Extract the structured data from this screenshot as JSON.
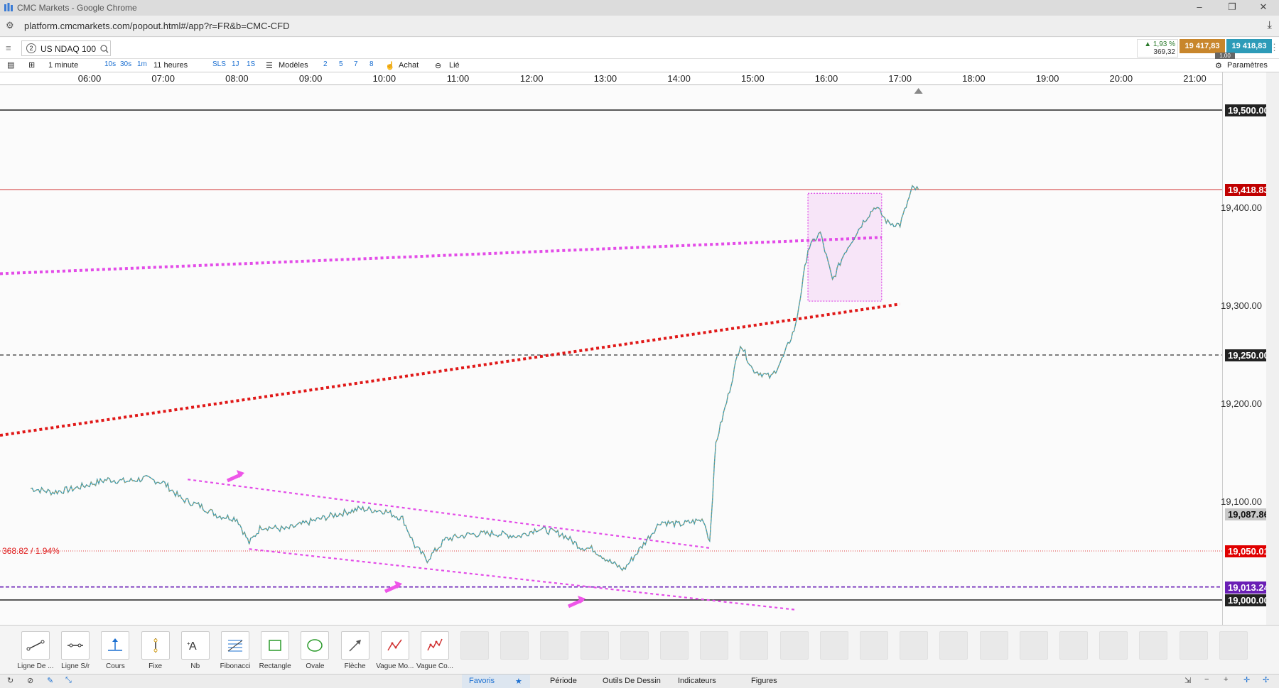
{
  "window": {
    "title": "CMC Markets - Google Chrome",
    "url": "platform.cmcmarkets.com/popout.html#/app?r=FR&b=CMC-CFD"
  },
  "instrument": {
    "badge_num": "2",
    "name": "US NDAQ 100",
    "change_pct": "▲ 1,93 %",
    "change_pts": "369,32",
    "sell": "19 417,83",
    "buy": "19 418,83",
    "spread": "1,00",
    "params": "Paramètres"
  },
  "toolbar": {
    "interval": "1 minute",
    "seg1": [
      "10s",
      "30s",
      "1m"
    ],
    "span": "11 heures",
    "seg2": [
      "SLS",
      "1J",
      "1S"
    ],
    "models": "Modèles",
    "seg3": [
      "2",
      "5",
      "7",
      "8"
    ],
    "buy": "Achat",
    "linked": "Lié"
  },
  "time_axis": [
    "06:00",
    "07:00",
    "08:00",
    "09:00",
    "10:00",
    "11:00",
    "12:00",
    "13:00",
    "14:00",
    "15:00",
    "16:00",
    "17:00",
    "18:00",
    "19:00",
    "20:00",
    "21:00"
  ],
  "price_axis": {
    "labels": [
      "19,400.00",
      "19,300.00",
      "19,200.00",
      "19,100.00"
    ],
    "levels": [
      19400,
      19300,
      19200,
      19100
    ]
  },
  "price_badges": [
    {
      "label": "19,500.00",
      "price": 19500,
      "color": "#222222"
    },
    {
      "label": "19,418.83",
      "price": 19418.83,
      "color": "#c00000"
    },
    {
      "label": "19,250.00",
      "price": 19250,
      "color": "#222222"
    },
    {
      "label": "19,087.86",
      "price": 19087.86,
      "color": "#c8c8c8",
      "text_color": "#111111"
    },
    {
      "label": "19,050.01",
      "price": 19050.01,
      "color": "#e00000"
    },
    {
      "label": "19,013.24",
      "price": 19013.24,
      "color": "#6a1fb5"
    },
    {
      "label": "19,000.00",
      "price": 19000,
      "color": "#222222"
    }
  ],
  "chart_annotation": "368.82 / 1.94%",
  "chart_data": {
    "type": "line",
    "title": "",
    "xlabel": "",
    "ylabel": "",
    "x_range": [
      "05:12",
      "21:30"
    ],
    "ylim": [
      18980,
      19520
    ],
    "series": [
      {
        "values": [
          [
            "05:12",
            19114
          ],
          [
            "05:30",
            19110
          ],
          [
            "05:45",
            19113
          ],
          [
            "06:00",
            19118
          ],
          [
            "06:15",
            19123
          ],
          [
            "06:30",
            19121
          ],
          [
            "06:45",
            19124
          ],
          [
            "07:00",
            19120
          ],
          [
            "07:15",
            19103
          ],
          [
            "07:30",
            19096
          ],
          [
            "07:45",
            19086
          ],
          [
            "08:00",
            19083
          ],
          [
            "08:10",
            19058
          ],
          [
            "08:20",
            19075
          ],
          [
            "08:40",
            19072
          ],
          [
            "09:00",
            19080
          ],
          [
            "09:20",
            19087
          ],
          [
            "09:40",
            19093
          ],
          [
            "10:00",
            19091
          ],
          [
            "10:15",
            19083
          ],
          [
            "10:25",
            19055
          ],
          [
            "10:35",
            19041
          ],
          [
            "10:50",
            19062
          ],
          [
            "11:10",
            19067
          ],
          [
            "11:30",
            19068
          ],
          [
            "11:50",
            19065
          ],
          [
            "12:05",
            19073
          ],
          [
            "12:25",
            19067
          ],
          [
            "12:40",
            19054
          ],
          [
            "12:50",
            19052
          ],
          [
            "13:05",
            19038
          ],
          [
            "13:15",
            19031
          ],
          [
            "13:30",
            19055
          ],
          [
            "13:45",
            19080
          ],
          [
            "14:00",
            19077
          ],
          [
            "14:20",
            19082
          ],
          [
            "14:25",
            19060
          ],
          [
            "14:30",
            19160
          ],
          [
            "14:40",
            19208
          ],
          [
            "14:50",
            19262
          ],
          [
            "15:00",
            19235
          ],
          [
            "15:15",
            19227
          ],
          [
            "15:25",
            19248
          ],
          [
            "15:35",
            19280
          ],
          [
            "15:45",
            19358
          ],
          [
            "15:55",
            19375
          ],
          [
            "16:05",
            19326
          ],
          [
            "16:15",
            19355
          ],
          [
            "16:30",
            19386
          ],
          [
            "16:40",
            19402
          ],
          [
            "16:50",
            19385
          ],
          [
            "17:00",
            19383
          ],
          [
            "17:10",
            19420
          ],
          [
            "17:15",
            19418.83
          ]
        ]
      }
    ]
  },
  "bottom_tools": [
    {
      "label": "Ligne De ...",
      "icon": "trendline-icon"
    },
    {
      "label": "Ligne S/r",
      "icon": "sr-line-icon"
    },
    {
      "label": "Cours",
      "icon": "price-icon"
    },
    {
      "label": "Fixe",
      "icon": "fixed-icon"
    },
    {
      "label": "Nb",
      "icon": "text-icon"
    },
    {
      "label": "Fibonacci",
      "icon": "fibonacci-icon"
    },
    {
      "label": "Rectangle",
      "icon": "rectangle-icon"
    },
    {
      "label": "Ovale",
      "icon": "oval-icon"
    },
    {
      "label": "Flèche",
      "icon": "arrow-icon"
    },
    {
      "label": "Vague Mo...",
      "icon": "wave-icon"
    },
    {
      "label": "Vague Co...",
      "icon": "wave2-icon"
    }
  ],
  "bottom_tabs": [
    "Favoris",
    "Période",
    "Outils De Dessin",
    "Indicateurs",
    "Figures"
  ]
}
